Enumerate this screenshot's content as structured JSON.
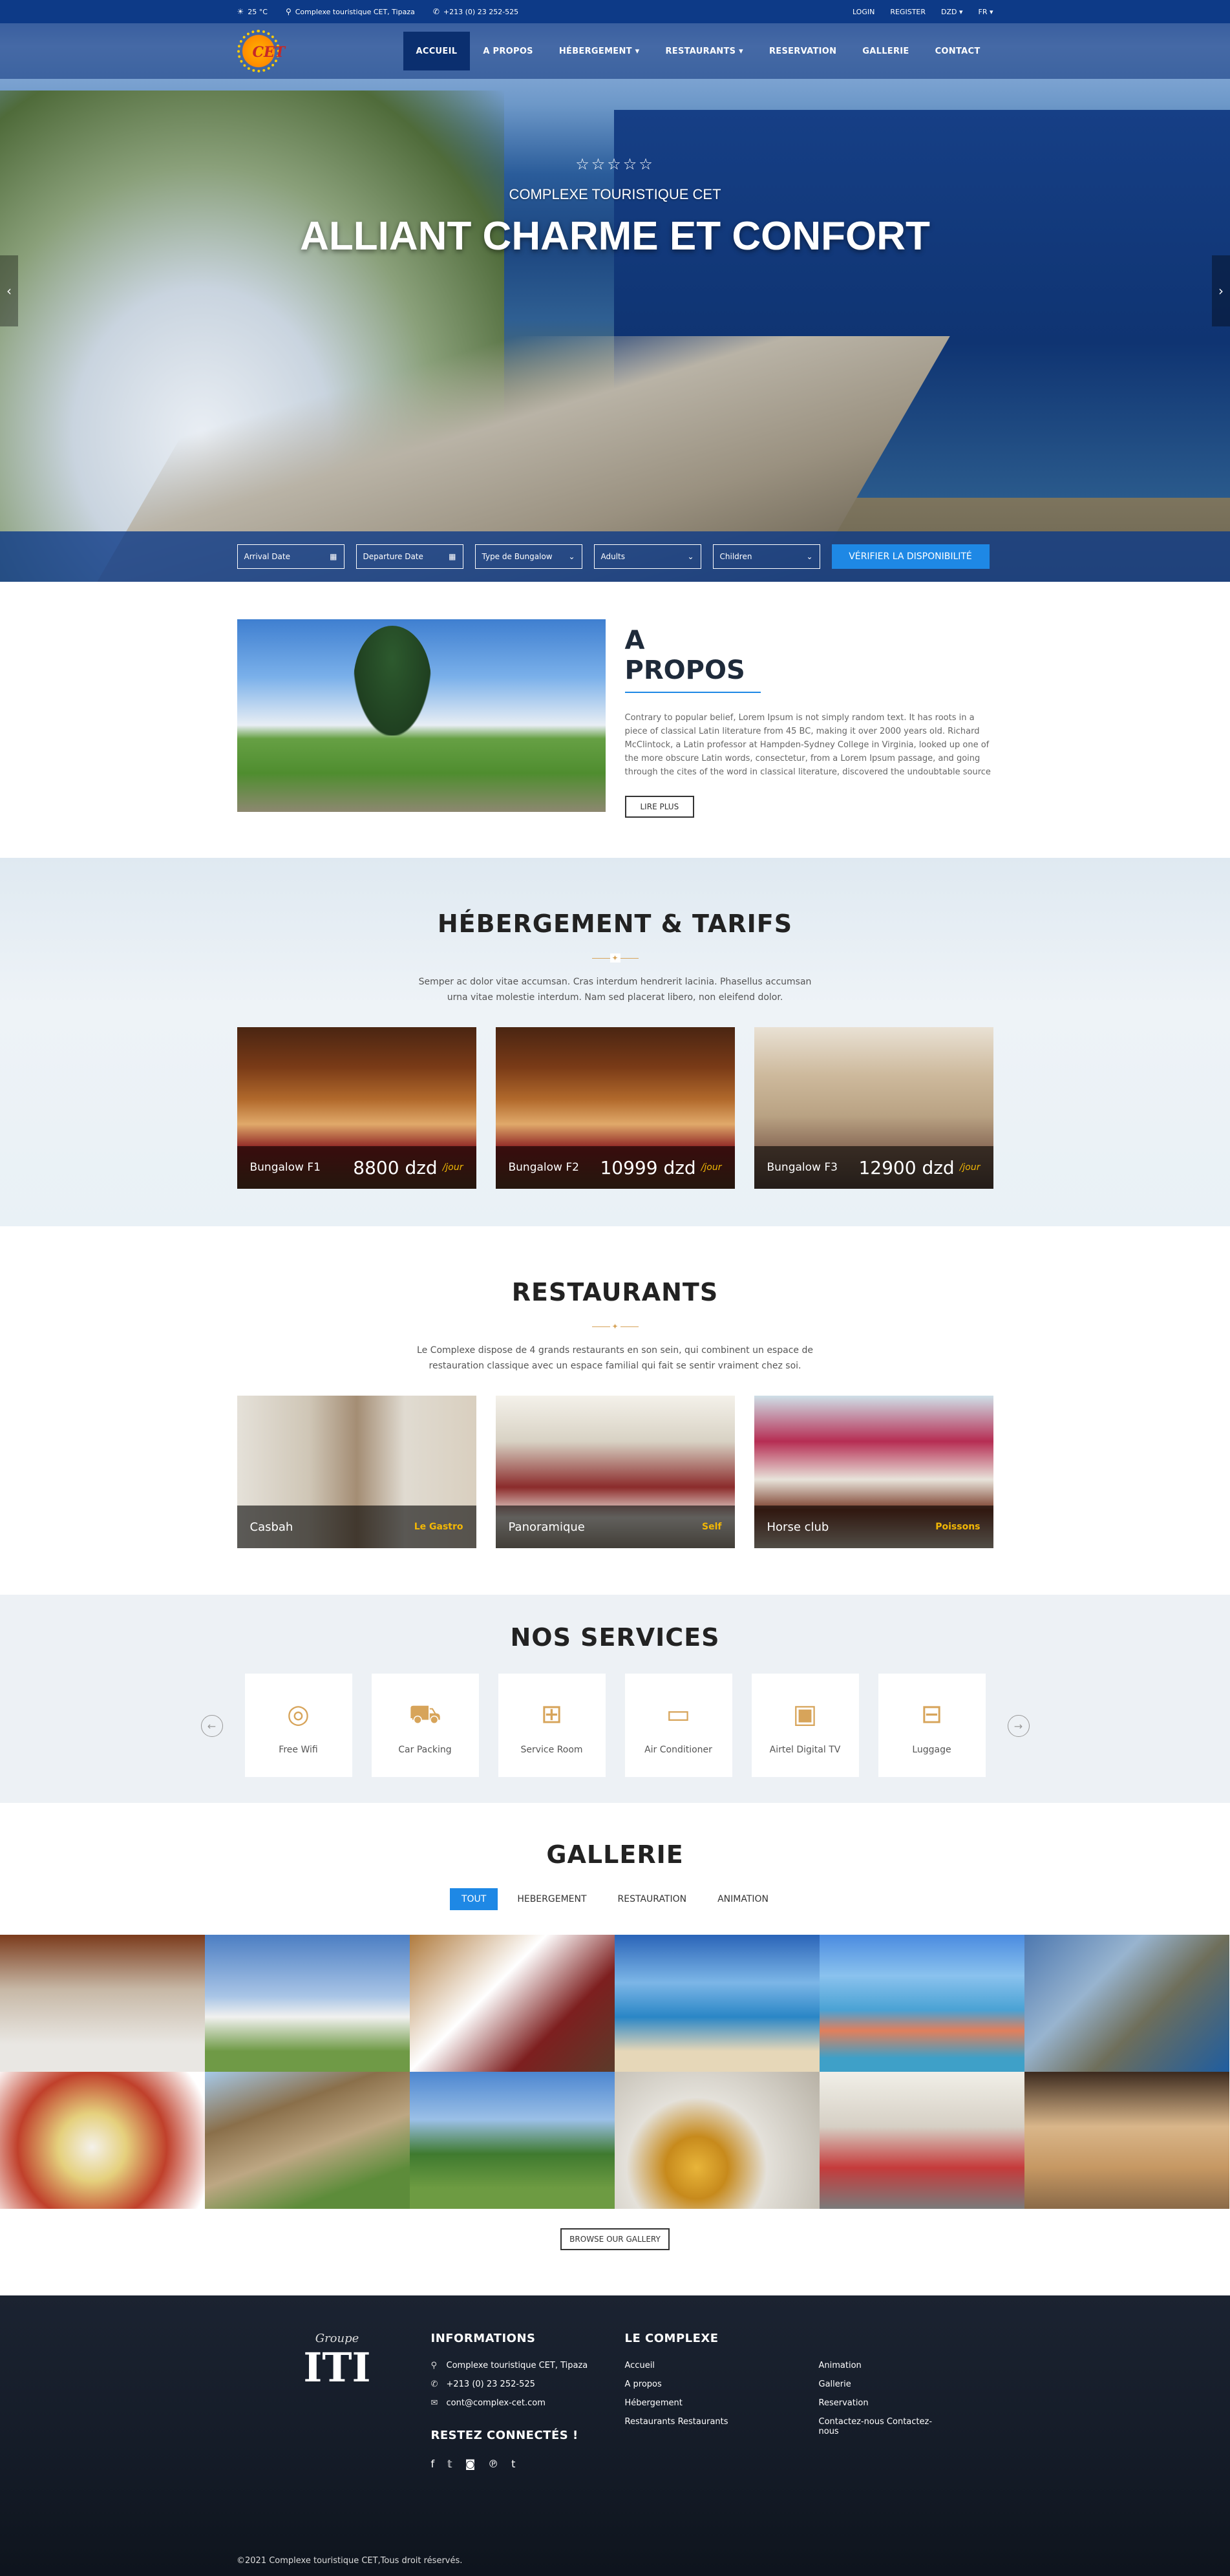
{
  "topbar": {
    "weather": "25 °C",
    "address": "Complexe touristique CET, Tipaza",
    "phone": "+213 (0) 23 252-525",
    "login": "LOGIN",
    "register": "REGISTER",
    "currency": "DZD ▾",
    "language": "FR ▾"
  },
  "nav": {
    "logo_text": "CET",
    "items": [
      "ACCUEIL",
      "A PROPOS",
      "HÉBERGEMENT ▾",
      "RESTAURANTS ▾",
      "RESERVATION",
      "GALLERIE",
      "CONTACT"
    ]
  },
  "hero": {
    "stars": "☆☆☆☆☆",
    "subtitle": "COMPLEXE TOURISTIQUE CET",
    "title": "ALLIANT CHARME ET CONFORT",
    "prev": "‹",
    "next": "›"
  },
  "booking": {
    "arrival": "Arrival Date",
    "departure": "Departure Date",
    "type": "Type de Bungalow",
    "adults": "Adults",
    "children": "Children",
    "button": "VÉRIFIER LA DISPONIBILITÉ"
  },
  "about": {
    "title": "A PROPOS",
    "text": "Contrary to popular belief, Lorem Ipsum is not simply random text. It has roots in a piece of classical Latin literature from 45 BC, making it over 2000 years old. Richard McClintock, a Latin professor at Hampden-Sydney College in Virginia, looked up one of the more obscure Latin words, consectetur, from a Lorem Ipsum passage, and going through the cites of the word in classical literature, discovered the undoubtable source",
    "button": "LIRE PLUS"
  },
  "hebergement": {
    "title": "HÉBERGEMENT & TARIFS",
    "desc": "Semper ac dolor vitae accumsan. Cras interdum hendrerit lacinia. Phasellus accumsan urna vitae molestie interdum. Nam sed placerat libero, non eleifend dolor.",
    "cards": [
      {
        "name": "Bungalow F1",
        "price": "8800 dzd",
        "unit": "/jour"
      },
      {
        "name": "Bungalow F2",
        "price": "10999 dzd",
        "unit": "/jour"
      },
      {
        "name": "Bungalow F3",
        "price": "12900 dzd",
        "unit": "/jour"
      }
    ]
  },
  "restaurants": {
    "title": "RESTAURANTS",
    "desc": "Le Complexe dispose de 4 grands restaurants en son sein, qui combinent un espace de restauration classique avec un espace familial qui fait se sentir vraiment chez soi.",
    "cards": [
      {
        "name": "Casbah",
        "tag": "Le Gastro"
      },
      {
        "name": "Panoramique",
        "tag": "Self"
      },
      {
        "name": "Horse club",
        "tag": "Poissons"
      }
    ]
  },
  "services": {
    "title": "NOS SERVICES",
    "items": [
      {
        "label": "Free Wifi",
        "icon": "wifi-icon"
      },
      {
        "label": "Car Packing",
        "icon": "car-icon"
      },
      {
        "label": "Service Room",
        "icon": "room-service-icon"
      },
      {
        "label": "Air Conditioner",
        "icon": "air-conditioner-icon"
      },
      {
        "label": "Airtel Digital TV",
        "icon": "tv-icon"
      },
      {
        "label": "Luggage",
        "icon": "luggage-icon"
      }
    ]
  },
  "gallery": {
    "title": "GALLERIE",
    "filters": [
      "TOUT",
      "HEBERGEMENT",
      "RESTAURATION",
      "ANIMATION"
    ],
    "button": "BROWSE OUR GALLERY"
  },
  "footer": {
    "logo_top": "Groupe",
    "logo_main": "ITI",
    "info_title": "INFORMATIONS",
    "address": "Complexe touristique CET, Tipaza",
    "phone": "+213 (0) 23 252-525",
    "email": "cont@complex-cet.com",
    "connect_title": "RESTEZ CONNECTÉS !",
    "complex_title": "LE COMPLEXE",
    "links": [
      "Accueil",
      "Animation",
      "A propos",
      "Gallerie",
      "Hébergement",
      "Reservation",
      "Restaurants Restaurants",
      "Contactez-nous Contactez-nous"
    ],
    "copyright": "©2021 Complexe touristique CET,Tous droit réservés."
  }
}
